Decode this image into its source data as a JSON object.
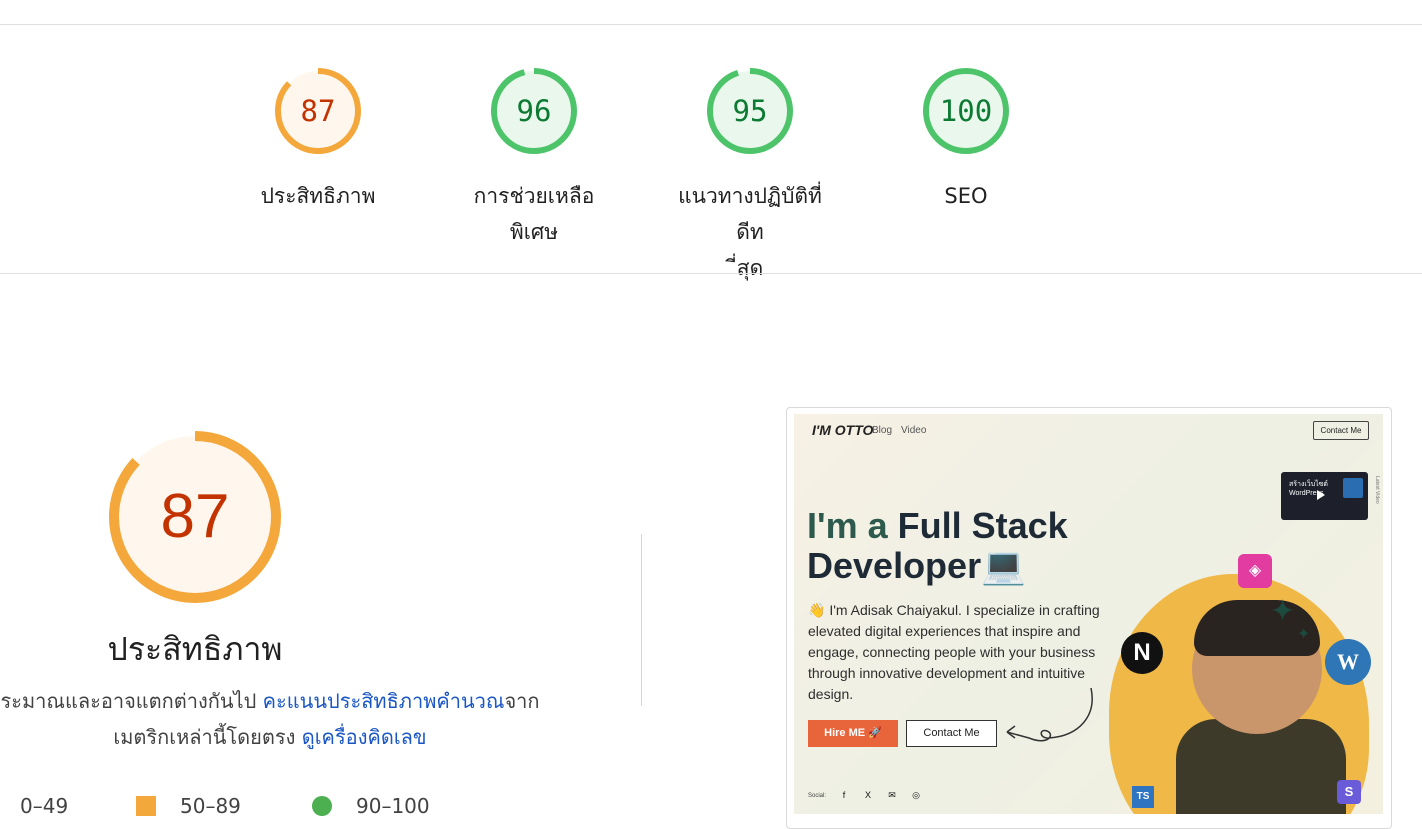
{
  "summary": {
    "gauges": [
      {
        "score": "87",
        "label": "ประสิทธิภาพ",
        "status": "average",
        "fraction": 0.87,
        "color": "#f4a73a",
        "text_color": "#c33300",
        "fill": "#fff6ed"
      },
      {
        "score": "96",
        "label": "การช่วยเหลือพิเศษ",
        "status": "pass",
        "fraction": 0.96,
        "color": "#4ec46a",
        "text_color": "#0c7a32",
        "fill": "#eaf7ec"
      },
      {
        "score": "95",
        "label": "แนวทางปฏิบัติที่ดีที่สุด",
        "status": "pass",
        "fraction": 0.95,
        "color": "#4ec46a",
        "text_color": "#0c7a32",
        "fill": "#eaf7ec"
      },
      {
        "score": "100",
        "label": "SEO",
        "status": "pass",
        "fraction": 1.0,
        "color": "#4ec46a",
        "text_color": "#0c7a32",
        "fill": "#eaf7ec"
      }
    ]
  },
  "performance": {
    "score": "87",
    "fraction": 0.87,
    "title": "ประสิทธิภาพ",
    "desc_prefix": "ระมาณและอาจแตกต่างกันไป ",
    "link_calc": "คะแนนประสิทธิภาพคำนวณ",
    "desc_mid": "จาก",
    "desc_line2": "เมตริกเหล่านี้โดยตรง ",
    "link_calculator": "ดูเครื่องคิดเลข",
    "legend": {
      "fail": "0–49",
      "average": "50–89",
      "pass": "90–100"
    }
  },
  "screenshot": {
    "logo": "I'M OTTO",
    "nav": [
      "Blog",
      "Video"
    ],
    "contact_top": "Contact Me",
    "video_text": "สร้างเว็บไซต์ WordPress",
    "latest_label": "Latest Video",
    "headline_line1_highlight": "I'm a ",
    "headline_line1_rest": "Full Stack",
    "headline_line2": "Developer💻",
    "paragraph": "👋 I'm Adisak Chaiyakul. I specialize in crafting elevated digital experiences that inspire and engage, connecting people with your business through innovative development and intuitive design.",
    "hire_button": "Hire ME 🚀",
    "contact_button": "Contact Me",
    "social_label": "Social:",
    "social_icons": [
      "f",
      "X",
      "✉",
      "◎"
    ],
    "badges": {
      "next": "N",
      "wordpress": "W",
      "graphql": "◈",
      "ts": "TS",
      "s": "S"
    }
  }
}
